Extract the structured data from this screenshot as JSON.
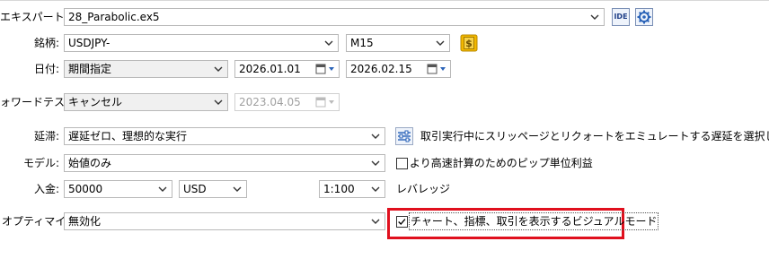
{
  "labels": {
    "expert": "エキスパート:",
    "symbol": "銘柄:",
    "date": "日付:",
    "forward": "ォワードテスト:",
    "delay": "延滞:",
    "model": "モデル:",
    "deposit": "入金:",
    "optimization": "オプティマイズ:"
  },
  "fields": {
    "expert_value": "28_Parabolic.ex5",
    "symbol_value": "USDJPY-",
    "timeframe_value": "M15",
    "date_mode_value": "期間指定",
    "date_from": "2026.01.01",
    "date_to": "2026.02.15",
    "forward_value": "キャンセル",
    "forward_date": "2023.04.05",
    "delay_value": "遅延ゼロ、理想的な実行",
    "model_value": "始値のみ",
    "deposit_value": "50000",
    "currency_value": "USD",
    "leverage_value": "1:100"
  },
  "buttons": {
    "ide_label": "IDE"
  },
  "texts": {
    "delay_description": "取引実行中にスリッページとリクォートをエミュレートする遅延を選択します",
    "model_checkbox_label": "より高速計算のためのピップ単位利益",
    "leverage_label": "レバレッジ",
    "visual_mode_label": "チャート、指標、取引を表示するビジュアルモード"
  },
  "states": {
    "model_checkbox_checked": false,
    "visual_mode_checked": true
  },
  "colors": {
    "highlight": "#e0101e",
    "symbol_icon_bg": "#f2b700"
  },
  "icons": {
    "settings": "gear-icon",
    "symbol_info": "dollar-icon",
    "delay_settings": "sliders-icon",
    "dropdown": "chevron-down-icon",
    "calendar": "calendar-icon"
  }
}
